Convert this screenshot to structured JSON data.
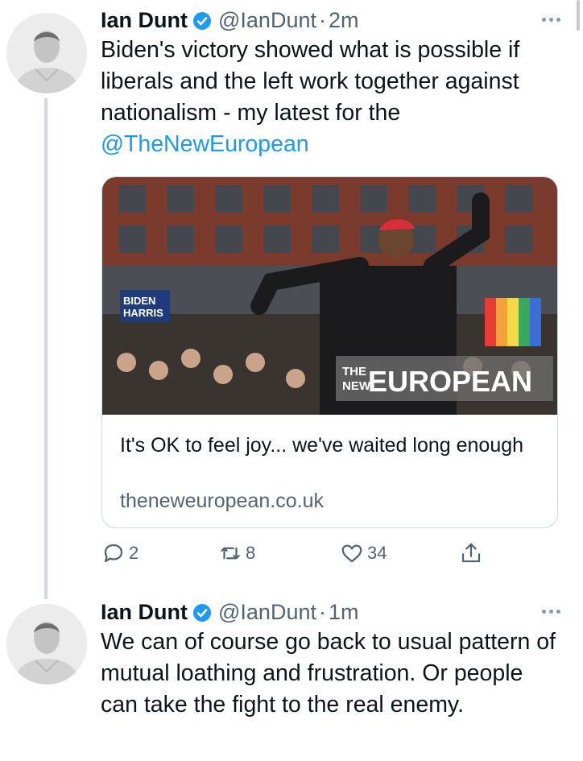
{
  "tweets": [
    {
      "author": {
        "name": "Ian Dunt",
        "handle": "@IanDunt",
        "avatar_icon": "avatar-photo"
      },
      "time": "2m",
      "text_main": "Biden's victory showed what is possible if liberals and the left work together against nationalism - my latest for the",
      "text_mention": "@TheNewEuropean",
      "card": {
        "title": "It's OK to feel joy... we've waited long enough",
        "domain": "theneweuropean.co.uk",
        "image": {
          "sign_line1": "BIDEN",
          "sign_line2": "HARRIS",
          "watermark_the": "THE",
          "watermark_new": "NEW",
          "watermark_european": "EUROPEAN"
        }
      },
      "actions": {
        "replies": "2",
        "retweets": "8",
        "likes": "34"
      }
    },
    {
      "author": {
        "name": "Ian Dunt",
        "handle": "@IanDunt",
        "avatar_icon": "avatar-photo"
      },
      "time": "1m",
      "text_main": "We can of course go back to usual pattern of mutual loathing and frustration. Or people can take the fight to the real enemy."
    }
  ],
  "colors": {
    "accent": "#1d9bf0",
    "secondary_text": "#536471",
    "border": "#cfd9de"
  }
}
